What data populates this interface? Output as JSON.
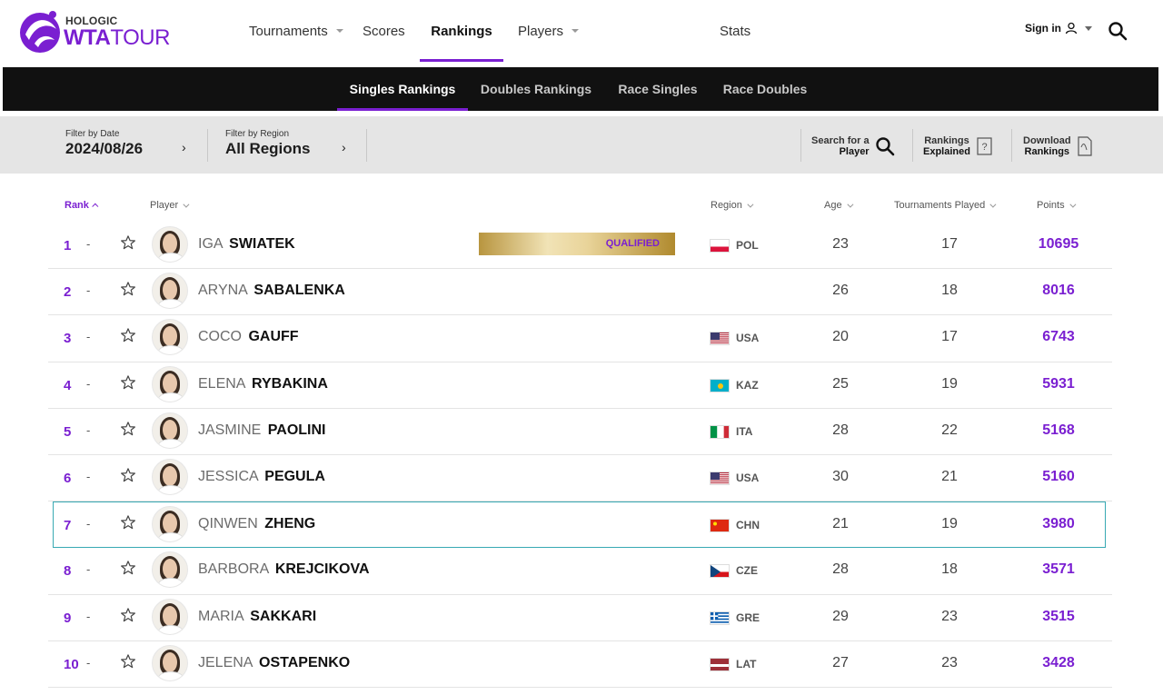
{
  "brand": {
    "hologic": "HOLOGIC",
    "wta": "WTA",
    "tour": "TOUR"
  },
  "nav": {
    "items": [
      {
        "label": "Tournaments",
        "has_menu": true
      },
      {
        "label": "Scores",
        "has_menu": false
      },
      {
        "label": "Rankings",
        "has_menu": false,
        "active": true
      },
      {
        "label": "Players",
        "has_menu": true
      },
      {
        "label": "Stats",
        "has_menu": false
      }
    ],
    "signin_label": "Sign in"
  },
  "subnav": {
    "items": [
      {
        "label": "Singles Rankings",
        "active": true
      },
      {
        "label": "Doubles Rankings"
      },
      {
        "label": "Race Singles"
      },
      {
        "label": "Race Doubles"
      }
    ]
  },
  "filters": {
    "date": {
      "label": "Filter by Date",
      "value": "2024/08/26"
    },
    "region": {
      "label": "Filter by Region",
      "value": "All Regions"
    }
  },
  "tools": {
    "search": {
      "line1": "Search for a",
      "line2": "Player"
    },
    "explained": {
      "line1": "Rankings",
      "line2": "Explained"
    },
    "download": {
      "line1": "Download",
      "line2": "Rankings"
    }
  },
  "table": {
    "headers": {
      "rank": "Rank",
      "player": "Player",
      "region": "Region",
      "age": "Age",
      "played": "Tournaments Played",
      "points": "Points"
    },
    "qualified_label": "QUALIFIED",
    "rows": [
      {
        "rank": "1",
        "move": "-",
        "first": "IGA",
        "last": "SWIATEK",
        "flag": "POL",
        "country": "POL",
        "age": "23",
        "played": "17",
        "points": "10695",
        "qualified": true
      },
      {
        "rank": "2",
        "move": "-",
        "first": "ARYNA",
        "last": "SABALENKA",
        "flag": "",
        "country": "",
        "age": "26",
        "played": "18",
        "points": "8016"
      },
      {
        "rank": "3",
        "move": "-",
        "first": "COCO",
        "last": "GAUFF",
        "flag": "USA",
        "country": "USA",
        "age": "20",
        "played": "17",
        "points": "6743"
      },
      {
        "rank": "4",
        "move": "-",
        "first": "ELENA",
        "last": "RYBAKINA",
        "flag": "KAZ",
        "country": "KAZ",
        "age": "25",
        "played": "19",
        "points": "5931"
      },
      {
        "rank": "5",
        "move": "-",
        "first": "JASMINE",
        "last": "PAOLINI",
        "flag": "ITA",
        "country": "ITA",
        "age": "28",
        "played": "22",
        "points": "5168"
      },
      {
        "rank": "6",
        "move": "-",
        "first": "JESSICA",
        "last": "PEGULA",
        "flag": "USA",
        "country": "USA",
        "age": "30",
        "played": "21",
        "points": "5160"
      },
      {
        "rank": "7",
        "move": "-",
        "first": "QINWEN",
        "last": "ZHENG",
        "flag": "CHN",
        "country": "CHN",
        "age": "21",
        "played": "19",
        "points": "3980",
        "highlighted": true
      },
      {
        "rank": "8",
        "move": "-",
        "first": "BARBORA",
        "last": "KREJCIKOVA",
        "flag": "CZE",
        "country": "CZE",
        "age": "28",
        "played": "18",
        "points": "3571"
      },
      {
        "rank": "9",
        "move": "-",
        "first": "MARIA",
        "last": "SAKKARI",
        "flag": "GRE",
        "country": "GRE",
        "age": "29",
        "played": "23",
        "points": "3515"
      },
      {
        "rank": "10",
        "move": "-",
        "first": "JELENA",
        "last": "OSTAPENKO",
        "flag": "LAT",
        "country": "LAT",
        "age": "27",
        "played": "23",
        "points": "3428"
      }
    ]
  },
  "colors": {
    "accent": "#7a1fd1",
    "subnav_bg": "#111111",
    "filter_bg": "#e5e5e5",
    "highlight": "#38a9b3"
  }
}
